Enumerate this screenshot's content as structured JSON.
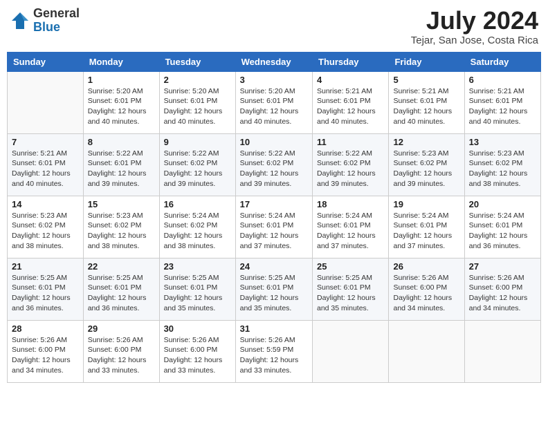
{
  "header": {
    "logo_general": "General",
    "logo_blue": "Blue",
    "month_year": "July 2024",
    "location": "Tejar, San Jose, Costa Rica"
  },
  "weekdays": [
    "Sunday",
    "Monday",
    "Tuesday",
    "Wednesday",
    "Thursday",
    "Friday",
    "Saturday"
  ],
  "weeks": [
    [
      {
        "day": "",
        "info": ""
      },
      {
        "day": "1",
        "info": "Sunrise: 5:20 AM\nSunset: 6:01 PM\nDaylight: 12 hours\nand 40 minutes."
      },
      {
        "day": "2",
        "info": "Sunrise: 5:20 AM\nSunset: 6:01 PM\nDaylight: 12 hours\nand 40 minutes."
      },
      {
        "day": "3",
        "info": "Sunrise: 5:20 AM\nSunset: 6:01 PM\nDaylight: 12 hours\nand 40 minutes."
      },
      {
        "day": "4",
        "info": "Sunrise: 5:21 AM\nSunset: 6:01 PM\nDaylight: 12 hours\nand 40 minutes."
      },
      {
        "day": "5",
        "info": "Sunrise: 5:21 AM\nSunset: 6:01 PM\nDaylight: 12 hours\nand 40 minutes."
      },
      {
        "day": "6",
        "info": "Sunrise: 5:21 AM\nSunset: 6:01 PM\nDaylight: 12 hours\nand 40 minutes."
      }
    ],
    [
      {
        "day": "7",
        "info": "Sunrise: 5:21 AM\nSunset: 6:01 PM\nDaylight: 12 hours\nand 40 minutes."
      },
      {
        "day": "8",
        "info": "Sunrise: 5:22 AM\nSunset: 6:01 PM\nDaylight: 12 hours\nand 39 minutes."
      },
      {
        "day": "9",
        "info": "Sunrise: 5:22 AM\nSunset: 6:02 PM\nDaylight: 12 hours\nand 39 minutes."
      },
      {
        "day": "10",
        "info": "Sunrise: 5:22 AM\nSunset: 6:02 PM\nDaylight: 12 hours\nand 39 minutes."
      },
      {
        "day": "11",
        "info": "Sunrise: 5:22 AM\nSunset: 6:02 PM\nDaylight: 12 hours\nand 39 minutes."
      },
      {
        "day": "12",
        "info": "Sunrise: 5:23 AM\nSunset: 6:02 PM\nDaylight: 12 hours\nand 39 minutes."
      },
      {
        "day": "13",
        "info": "Sunrise: 5:23 AM\nSunset: 6:02 PM\nDaylight: 12 hours\nand 38 minutes."
      }
    ],
    [
      {
        "day": "14",
        "info": "Sunrise: 5:23 AM\nSunset: 6:02 PM\nDaylight: 12 hours\nand 38 minutes."
      },
      {
        "day": "15",
        "info": "Sunrise: 5:23 AM\nSunset: 6:02 PM\nDaylight: 12 hours\nand 38 minutes."
      },
      {
        "day": "16",
        "info": "Sunrise: 5:24 AM\nSunset: 6:02 PM\nDaylight: 12 hours\nand 38 minutes."
      },
      {
        "day": "17",
        "info": "Sunrise: 5:24 AM\nSunset: 6:01 PM\nDaylight: 12 hours\nand 37 minutes."
      },
      {
        "day": "18",
        "info": "Sunrise: 5:24 AM\nSunset: 6:01 PM\nDaylight: 12 hours\nand 37 minutes."
      },
      {
        "day": "19",
        "info": "Sunrise: 5:24 AM\nSunset: 6:01 PM\nDaylight: 12 hours\nand 37 minutes."
      },
      {
        "day": "20",
        "info": "Sunrise: 5:24 AM\nSunset: 6:01 PM\nDaylight: 12 hours\nand 36 minutes."
      }
    ],
    [
      {
        "day": "21",
        "info": "Sunrise: 5:25 AM\nSunset: 6:01 PM\nDaylight: 12 hours\nand 36 minutes."
      },
      {
        "day": "22",
        "info": "Sunrise: 5:25 AM\nSunset: 6:01 PM\nDaylight: 12 hours\nand 36 minutes."
      },
      {
        "day": "23",
        "info": "Sunrise: 5:25 AM\nSunset: 6:01 PM\nDaylight: 12 hours\nand 35 minutes."
      },
      {
        "day": "24",
        "info": "Sunrise: 5:25 AM\nSunset: 6:01 PM\nDaylight: 12 hours\nand 35 minutes."
      },
      {
        "day": "25",
        "info": "Sunrise: 5:25 AM\nSunset: 6:01 PM\nDaylight: 12 hours\nand 35 minutes."
      },
      {
        "day": "26",
        "info": "Sunrise: 5:26 AM\nSunset: 6:00 PM\nDaylight: 12 hours\nand 34 minutes."
      },
      {
        "day": "27",
        "info": "Sunrise: 5:26 AM\nSunset: 6:00 PM\nDaylight: 12 hours\nand 34 minutes."
      }
    ],
    [
      {
        "day": "28",
        "info": "Sunrise: 5:26 AM\nSunset: 6:00 PM\nDaylight: 12 hours\nand 34 minutes."
      },
      {
        "day": "29",
        "info": "Sunrise: 5:26 AM\nSunset: 6:00 PM\nDaylight: 12 hours\nand 33 minutes."
      },
      {
        "day": "30",
        "info": "Sunrise: 5:26 AM\nSunset: 6:00 PM\nDaylight: 12 hours\nand 33 minutes."
      },
      {
        "day": "31",
        "info": "Sunrise: 5:26 AM\nSunset: 5:59 PM\nDaylight: 12 hours\nand 33 minutes."
      },
      {
        "day": "",
        "info": ""
      },
      {
        "day": "",
        "info": ""
      },
      {
        "day": "",
        "info": ""
      }
    ]
  ]
}
